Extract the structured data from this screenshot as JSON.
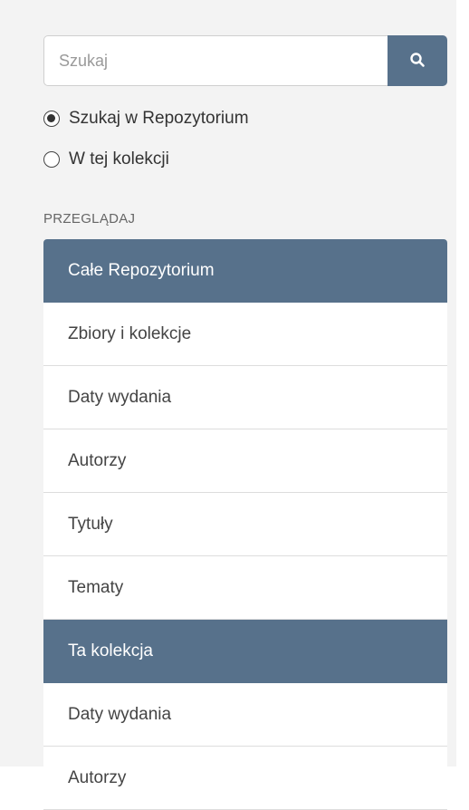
{
  "search": {
    "placeholder": "Szukaj",
    "value": "",
    "button_icon": "search-icon"
  },
  "scope": {
    "options": [
      {
        "label": "Szukaj w Repozytorium",
        "selected": true
      },
      {
        "label": "W tej kolekcji",
        "selected": false
      }
    ]
  },
  "browse": {
    "heading": "PRZEGLĄDAJ",
    "sections": [
      {
        "title": "Całe Repozytorium",
        "items": [
          "Zbiory i kolekcje",
          "Daty wydania",
          "Autorzy",
          "Tytuły",
          "Tematy"
        ]
      },
      {
        "title": "Ta kolekcja",
        "items": [
          "Daty wydania",
          "Autorzy"
        ]
      }
    ]
  },
  "colors": {
    "accent": "#57718b",
    "panel_background": "#f3f3f3"
  }
}
